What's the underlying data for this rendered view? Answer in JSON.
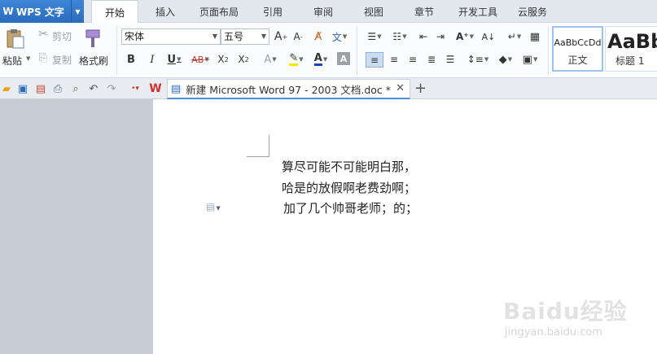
{
  "app": {
    "name": "WPS 文字",
    "logo": "W"
  },
  "menu_tabs": [
    "开始",
    "插入",
    "页面布局",
    "引用",
    "审阅",
    "视图",
    "章节",
    "开发工具",
    "云服务"
  ],
  "active_tab": "开始",
  "clipboard": {
    "paste": "粘贴",
    "cut": "剪切",
    "copy": "复制",
    "format_painter": "格式刷"
  },
  "font": {
    "family": "宋体",
    "size": "五号"
  },
  "styles": [
    {
      "sample": "AaBbCcDd",
      "name": "正文"
    },
    {
      "sample": "AaBb",
      "name": "标题 1"
    }
  ],
  "doc_tab": {
    "title": "新建 Microsoft Word 97 - 2003 文档.doc *"
  },
  "document": {
    "lines": [
      "算尽可能不可能明白那，",
      "哈是的放假啊老费劲啊；",
      "加了几个帅哥老师；的；"
    ]
  },
  "watermark": {
    "brand": "Baidu经验",
    "url": "jingyan.baidu.com"
  },
  "colors": {
    "accent": "#2a6bbd",
    "highlight": "#f5e600",
    "font_color": "#1f3fbf"
  }
}
